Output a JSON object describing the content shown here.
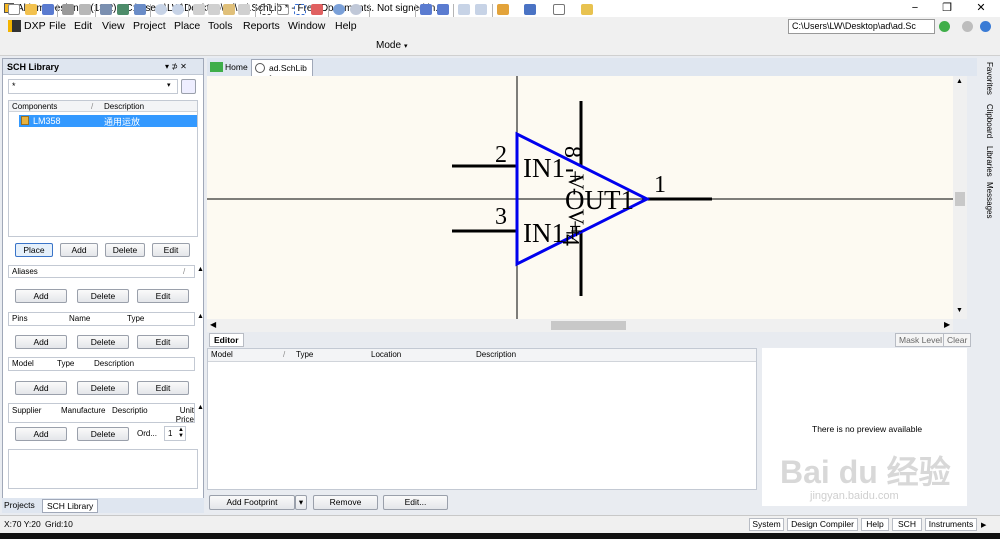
{
  "window": {
    "title": "Altium Designer (13.2) - C:\\Users\\LW\\Desktop\\ad\\ad.SchLib * - Free Documents. Not signed in.",
    "minimize": "−",
    "restore": "❐",
    "close": "✕"
  },
  "menu": {
    "items": [
      "DXP",
      "File",
      "Edit",
      "View",
      "Project",
      "Place",
      "Tools",
      "Reports",
      "Window",
      "Help"
    ],
    "path": "C:\\Users\\LW\\Desktop\\ad\\ad.Sc"
  },
  "toolbar": {
    "mode_label": "Mode"
  },
  "panel": {
    "title": "SCH Library",
    "pin_label": "▾ ⊅ ✕",
    "filter_value": "*",
    "components": {
      "headers": [
        "Components",
        "Description"
      ],
      "rows": [
        {
          "name": "LM358",
          "description": "通用运放"
        }
      ]
    },
    "comp_buttons": [
      "Place",
      "Add",
      "Delete",
      "Edit"
    ],
    "aliases": {
      "header": "Aliases",
      "buttons": [
        "Add",
        "Delete",
        "Edit"
      ]
    },
    "pins": {
      "headers": [
        "Pins",
        "Name",
        "Type"
      ],
      "buttons": [
        "Add",
        "Delete",
        "Edit"
      ]
    },
    "model": {
      "headers": [
        "Model",
        "Type",
        "Description"
      ],
      "buttons": [
        "Add",
        "Delete",
        "Edit"
      ]
    },
    "supplier": {
      "headers": [
        "Supplier",
        "Manufacture",
        "Descriptio",
        "Unit Price"
      ],
      "buttons": [
        "Add",
        "Delete"
      ],
      "order_label": "Ord...",
      "order_value": "1"
    },
    "bottom_tabs": [
      "Projects",
      "SCH Library"
    ]
  },
  "doc_tabs": [
    "Home",
    "ad.SchLib *"
  ],
  "schematic": {
    "pins": [
      {
        "number": "2",
        "name": "IN1-",
        "sign": "-"
      },
      {
        "number": "3",
        "name": "IN1+",
        "sign": "+"
      },
      {
        "number": "1",
        "name": "OUT1"
      }
    ],
    "supply_pins": [
      "8",
      "4"
    ],
    "supply_labels": [
      "V+",
      "V-"
    ],
    "plus_sign": "+"
  },
  "editor": {
    "tab": "Editor",
    "mask_level": "Mask Level",
    "clear": "Clear",
    "headers": [
      "Model",
      "Type",
      "Location",
      "Description"
    ],
    "preview_text": "There is no preview available",
    "buttons": {
      "add_footprint": "Add Footprint",
      "remove": "Remove",
      "edit": "Edit..."
    }
  },
  "right_panels": [
    "Favorites",
    "Clipboard",
    "Libraries",
    "Messages"
  ],
  "status": {
    "coords": "X:70 Y:20",
    "grid": "Grid:10",
    "buttons": [
      "System",
      "Design Compiler",
      "Help",
      "SCH",
      "Instruments"
    ]
  },
  "watermark": {
    "brand": "Bai du 经验",
    "url": "jingyan.baidu.com"
  },
  "colors": {
    "selection": "#3399ff",
    "opamp_outline": "#0000ee",
    "panel_header": "#dfe6f0"
  }
}
